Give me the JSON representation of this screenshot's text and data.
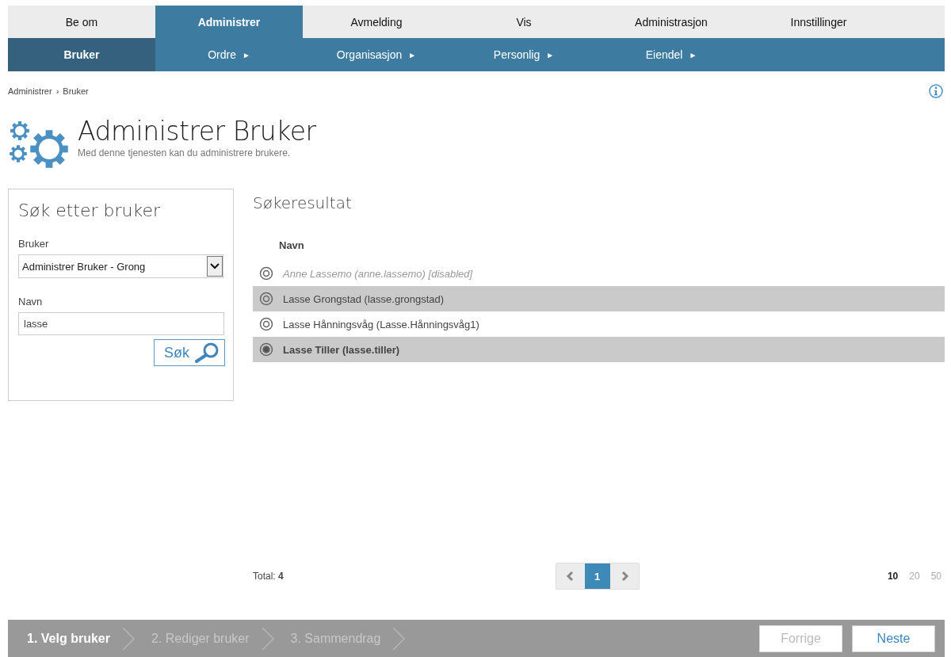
{
  "top_menu": [
    {
      "label": "Be om",
      "selected": false
    },
    {
      "label": "Administrer",
      "selected": true
    },
    {
      "label": "Avmelding",
      "selected": false
    },
    {
      "label": "Vis",
      "selected": false
    },
    {
      "label": "Administrasjon",
      "selected": false
    },
    {
      "label": "Innstillinger",
      "selected": false
    }
  ],
  "sub_menu": [
    {
      "label": "Bruker",
      "selected": true
    },
    {
      "label": "Ordre",
      "selected": false,
      "arrow": "►"
    },
    {
      "label": "Organisasjon",
      "selected": false,
      "arrow": "►"
    },
    {
      "label": "Personlig",
      "selected": false,
      "arrow": "►"
    },
    {
      "label": "Eiendel",
      "selected": false,
      "arrow": "►"
    }
  ],
  "breadcrumb": {
    "items": [
      "Administrer",
      "Bruker"
    ],
    "separator": "›"
  },
  "header": {
    "title": "Administrer Bruker",
    "subtitle": "Med denne tjenesten kan du administrere brukere."
  },
  "search_panel": {
    "title": "Søk etter bruker",
    "user_label": "Bruker",
    "user_value": "Administrer Bruker - Grong",
    "name_label": "Navn",
    "name_value": "lasse",
    "search_button": "Søk"
  },
  "results": {
    "title": "Søkeresultat",
    "column": "Navn",
    "rows": [
      {
        "name": "Anne Lassemo (anne.lassemo) [disabled]",
        "disabled": true,
        "highlighted": false,
        "selected": false
      },
      {
        "name": "Lasse Grongstad (lasse.grongstad)",
        "disabled": false,
        "highlighted": true,
        "selected": false
      },
      {
        "name": "Lasse Hånningsvåg (Lasse.Hånningsvåg1)",
        "disabled": false,
        "highlighted": false,
        "selected": false
      },
      {
        "name": "Lasse Tiller (lasse.tiller)",
        "disabled": false,
        "highlighted": true,
        "selected": true
      }
    ],
    "total_label": "Total:",
    "total": "4",
    "pages": [
      {
        "label": "1",
        "selected": true
      }
    ],
    "page_sizes": [
      {
        "label": "10",
        "selected": true
      },
      {
        "label": "20",
        "selected": false
      },
      {
        "label": "50",
        "selected": false
      }
    ]
  },
  "wizard": {
    "steps": [
      {
        "label": "1. Velg bruker",
        "selected": true
      },
      {
        "label": "2. Rediger bruker",
        "selected": false
      },
      {
        "label": "3. Sammendrag",
        "selected": false
      }
    ],
    "buttons": [
      {
        "label": "Forrige",
        "disabled": true
      },
      {
        "label": "Neste",
        "disabled": false
      }
    ]
  }
}
